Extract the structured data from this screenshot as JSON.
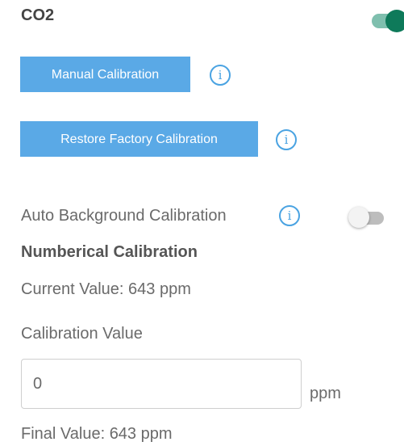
{
  "section": {
    "title": "CO2",
    "enabled": true
  },
  "buttons": {
    "manual_calibration": "Manual Calibration",
    "restore_factory_calibration": "Restore Factory Calibration"
  },
  "info_icon_glyph": "i",
  "auto_background": {
    "label": "Auto Background Calibration",
    "enabled": false
  },
  "numerical": {
    "heading": "Numberical Calibration",
    "current_value": "Current Value: 643 ppm",
    "calibration_label": "Calibration Value",
    "calibration_input_value": "0",
    "unit": "ppm",
    "final_value": "Final Value: 643 ppm"
  },
  "colors": {
    "accent_blue": "#5aa9e6",
    "toggle_on": "#0e7a5a",
    "toggle_off": "#bdbdbd"
  }
}
